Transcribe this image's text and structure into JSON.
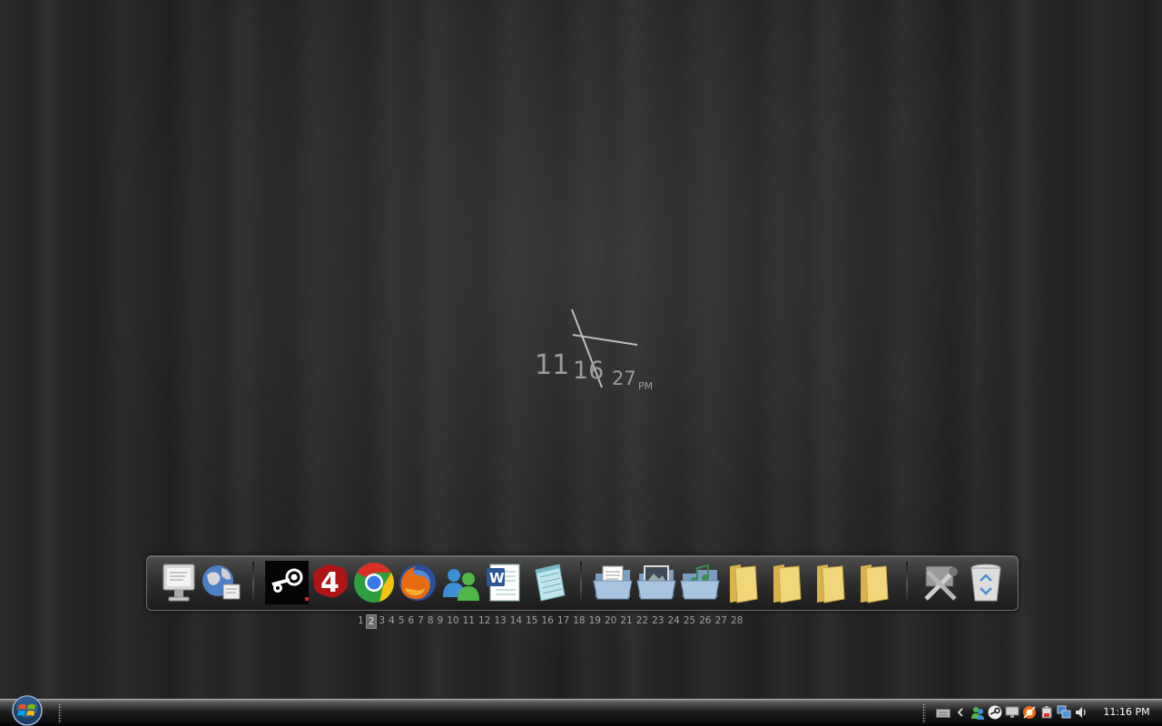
{
  "clock": {
    "hour": "11",
    "minute": "16",
    "second": "27",
    "ampm": "PM"
  },
  "dock": {
    "items": [
      {
        "icon": "computer-monitor-icon"
      },
      {
        "icon": "network-globe-icon"
      },
      {
        "icon": "steam-icon"
      },
      {
        "icon": "left4dead-icon"
      },
      {
        "icon": "chrome-icon"
      },
      {
        "icon": "firefox-icon"
      },
      {
        "icon": "messenger-icon"
      },
      {
        "icon": "word-icon"
      },
      {
        "icon": "notepad-icon"
      },
      {
        "icon": "documents-folder-icon"
      },
      {
        "icon": "pictures-folder-icon"
      },
      {
        "icon": "music-folder-icon"
      },
      {
        "icon": "folder-icon"
      },
      {
        "icon": "folder-icon"
      },
      {
        "icon": "folder-icon"
      },
      {
        "icon": "folder-icon"
      },
      {
        "icon": "tools-icon"
      },
      {
        "icon": "recycle-bin-icon"
      }
    ]
  },
  "pager": {
    "active": "2",
    "pages": [
      "1",
      "2",
      "3",
      "4",
      "5",
      "6",
      "7",
      "8",
      "9",
      "10",
      "11",
      "12",
      "13",
      "14",
      "15",
      "16",
      "17",
      "18",
      "19",
      "20",
      "21",
      "22",
      "23",
      "24",
      "25",
      "26",
      "27",
      "28"
    ]
  },
  "taskbar": {
    "tray_icons": [
      "keyboard-icon",
      "chevron-left-icon",
      "messenger-tray-icon",
      "steam-tray-icon",
      "display-icon",
      "antivirus-icon",
      "power-icon",
      "network-icon",
      "volume-icon"
    ],
    "time": "11:16 PM"
  },
  "colors": {
    "clock_text": "#9c9c9c",
    "folder_yellow": "#e8c860",
    "wallpaper": "#262626"
  }
}
